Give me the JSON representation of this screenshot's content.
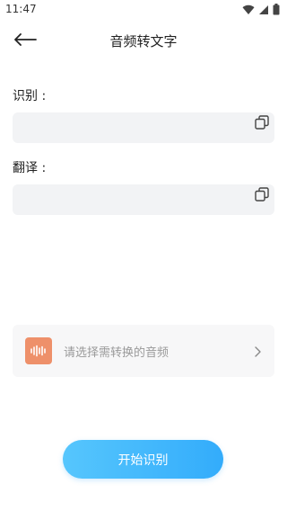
{
  "status_bar": {
    "time": "11:47"
  },
  "header": {
    "title": "音频转文字"
  },
  "recognition": {
    "label": "识别 :",
    "value": ""
  },
  "translation": {
    "label": "翻译 :",
    "value": ""
  },
  "audio_select": {
    "placeholder": "请选择需转换的音频",
    "icon_color": "#ee906a"
  },
  "start_button": {
    "label": "开始识别",
    "gradient": [
      "#56c6fd",
      "#33acfb"
    ]
  },
  "icons": [
    "back-arrow-icon",
    "copy-icon",
    "audio-wave-icon",
    "chevron-right-icon",
    "wifi-icon",
    "signal-icon",
    "battery-icon"
  ]
}
